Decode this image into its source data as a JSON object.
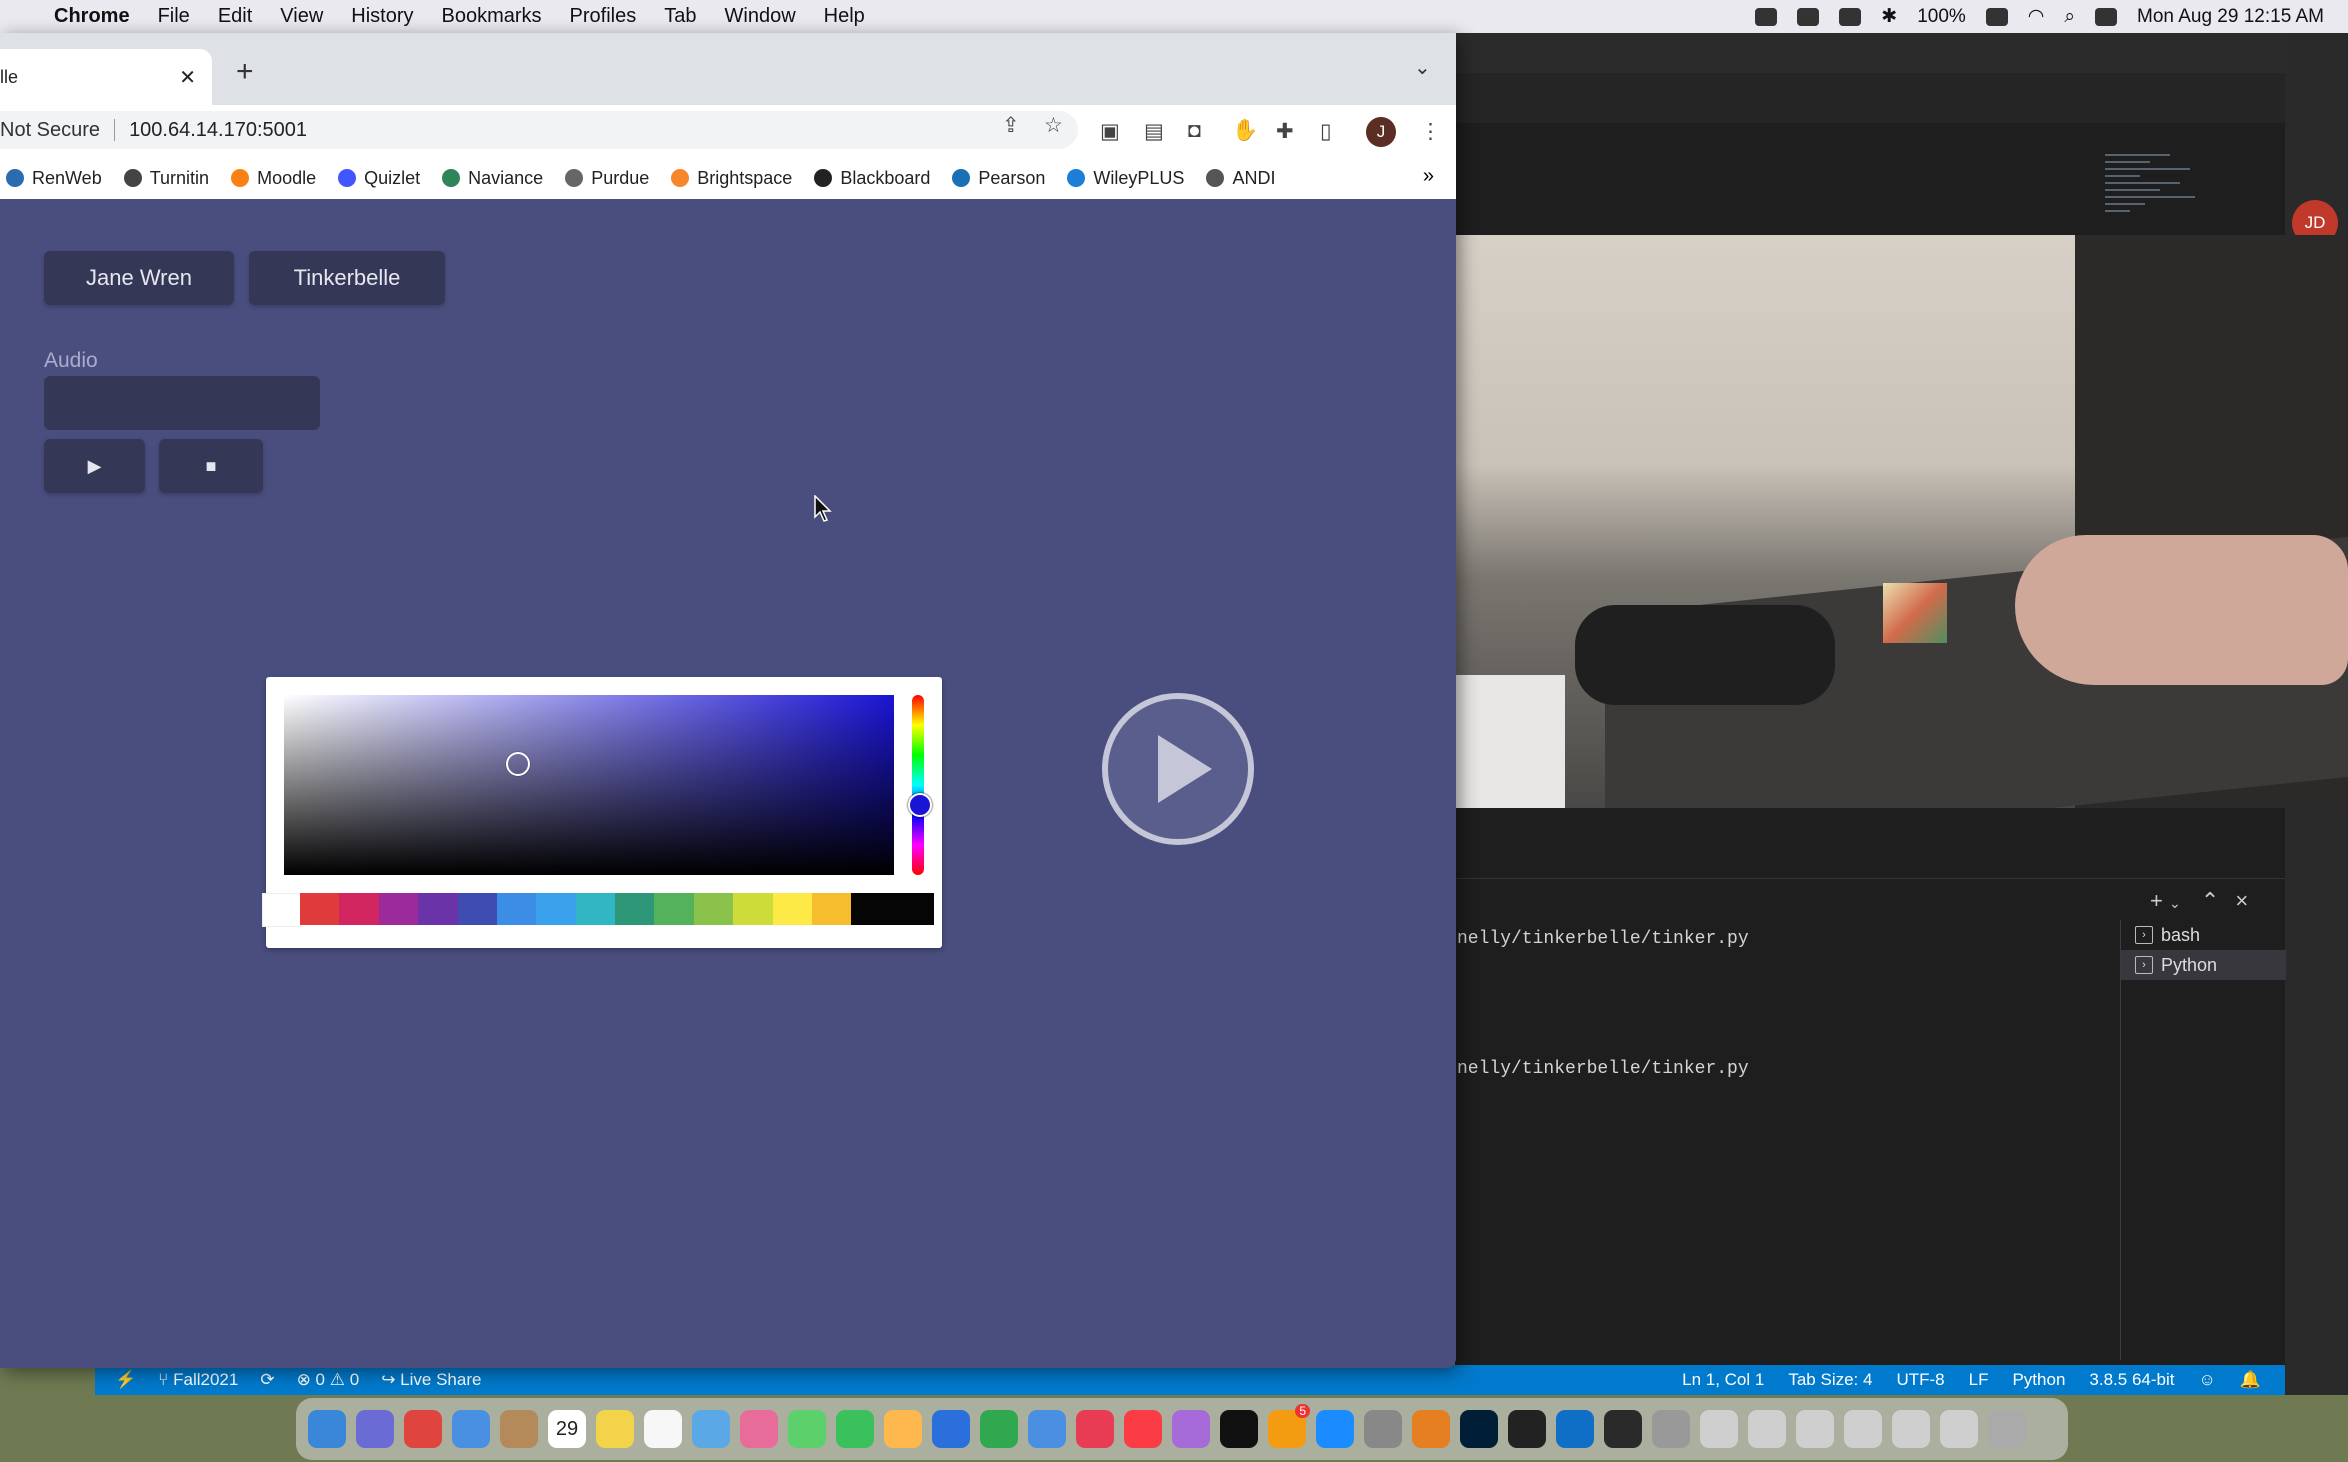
{
  "menubar": {
    "app": "Chrome",
    "items": [
      "File",
      "Edit",
      "View",
      "History",
      "Bookmarks",
      "Profiles",
      "Tab",
      "Window",
      "Help"
    ],
    "battery": "100%",
    "datetime": "Mon Aug 29  12:15 AM"
  },
  "chrome": {
    "tab_title": "lle",
    "not_secure": "Not Secure",
    "url": "100.64.14.170:5001",
    "profile_initial": "J",
    "bookmarks": [
      {
        "label": "RenWeb",
        "color": "#2b6cb0"
      },
      {
        "label": "Turnitin",
        "color": "#444"
      },
      {
        "label": "Moodle",
        "color": "#f98012"
      },
      {
        "label": "Quizlet",
        "color": "#4255ff"
      },
      {
        "label": "Naviance",
        "color": "#2f855a"
      },
      {
        "label": "Purdue",
        "color": "#666"
      },
      {
        "label": "Brightspace",
        "color": "#f6862a"
      },
      {
        "label": "Blackboard",
        "color": "#222"
      },
      {
        "label": "Pearson",
        "color": "#1a6fb5"
      },
      {
        "label": "WileyPLUS",
        "color": "#1c7ed6"
      },
      {
        "label": "ANDI",
        "color": "#555"
      }
    ],
    "bookmarks_more": "»"
  },
  "page": {
    "buttons": [
      "Jane Wren",
      "Tinkerbelle"
    ],
    "audio_label": "Audio",
    "play_symbol": "▶",
    "stop_symbol": "■",
    "swatches": [
      "#e03b3b",
      "#d1265f",
      "#9b2a9b",
      "#6a34a8",
      "#3f4db3",
      "#3c8de6",
      "#3aa2ec",
      "#31b6c4",
      "#2d9778",
      "#54b25b",
      "#8ac24b",
      "#cddc39",
      "#fdea46",
      "#f6bd2f",
      "#050505"
    ]
  },
  "vscode": {
    "avatar": "JD",
    "terminal_lines": [
      "nelly/tinkerbelle/tinker.py",
      "nelly/tinkerbelle/tinker.py"
    ],
    "terminals": [
      "bash",
      "Python"
    ],
    "status_left": [
      "Fall2021",
      "0",
      "0",
      "Live Share"
    ],
    "status_right": [
      "Ln 1, Col 1",
      "Tab Size: 4",
      "UTF-8",
      "LF",
      "Python",
      "3.8.5 64-bit"
    ]
  },
  "dock": {
    "calendar_day": "29",
    "badge": "5"
  }
}
